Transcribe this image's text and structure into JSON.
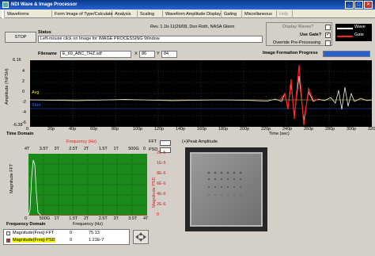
{
  "window": {
    "title": "NDI Wave & Image Processor"
  },
  "tabs": [
    {
      "label": "Waveforms"
    },
    {
      "label": "Form Image of Type/Calculate"
    },
    {
      "label": "Analysis"
    },
    {
      "label": "Scaling"
    },
    {
      "label": "Waveform Amplitude Display"
    },
    {
      "label": "Gating"
    },
    {
      "label": "Miscellaneous"
    },
    {
      "label": "Help"
    }
  ],
  "header": {
    "stop_label": "STOP",
    "revision": "Rev. 1.1b-11(26/08, Don Roth, NASA Glenn",
    "status_label": "Status",
    "status_text": "Left-mouse click on Image for IMAGE PROCESSING Window",
    "display_waves_label": "Display Waves?",
    "use_gate_label": "Use Gate?",
    "override_label": "Override Pre-Processing",
    "wave_label": "Wave",
    "gate_label": "Gate",
    "filename_label": "Filename",
    "filename_value": "E_69_ABC_THZ.xdf",
    "x_label": "X",
    "x_value": "86",
    "y_label": "Y",
    "y_value": "84",
    "progress_label": "Image Formation Progress",
    "progress": 1.0
  },
  "time_plot": {
    "title": "Time Domain",
    "ylabel": "Amplitude (%FSH)",
    "xlabel": "Time (sec)",
    "top_tick": "6.16",
    "avg_label": "Avg",
    "start_label": "Start",
    "yticks": [
      "4",
      "2",
      "0",
      "-2",
      "-4",
      "-6"
    ],
    "ytick_bottom": "-6.38",
    "xticks": [
      "0",
      "20p",
      "40p",
      "60p",
      "80p",
      "100p",
      "120p",
      "140p",
      "160p",
      "180p",
      "200p",
      "220p",
      "240p",
      "260p",
      "280p",
      "300p",
      "320p"
    ]
  },
  "freq_plot": {
    "title": "Frequency Domain",
    "top_label": "Frequency (Hz)",
    "top_ticks": [
      "4T",
      "3.5T",
      "3T",
      "2.5T",
      "2T",
      "1.5T",
      "1T",
      "500G",
      "0"
    ],
    "bottom_ticks": [
      "0",
      "500G",
      "1T",
      "1.5T",
      "2T",
      "2.5T",
      "3T",
      "3.5T",
      "4T"
    ],
    "xlabel": "Frequency (Hz)",
    "left_ylabel": "Magnitude FFT",
    "right_ylabel": "Magnitude PSD",
    "right_ticks": [
      "2E-5",
      "1E-5",
      "8E-6",
      "6E-6",
      "4E-6",
      "2E-6",
      "0"
    ],
    "fft_label": "FFT",
    "psd_label": "PSD"
  },
  "legend": {
    "rows": [
      {
        "name": "Magnitude(Freq) FFT",
        "col1": "0",
        "col2": "75.13"
      },
      {
        "name": "Magnitude(Freq) PSD",
        "col1": "0",
        "col2": "1.21E-7"
      }
    ]
  },
  "image_panel": {
    "title": "(+)Peak Amplitude"
  },
  "colors": {
    "wave": "#ffffff",
    "gate": "#ff2020",
    "fft": "#ffffff",
    "psd": "#ff2020",
    "plot_green": "#1a8a1a"
  }
}
